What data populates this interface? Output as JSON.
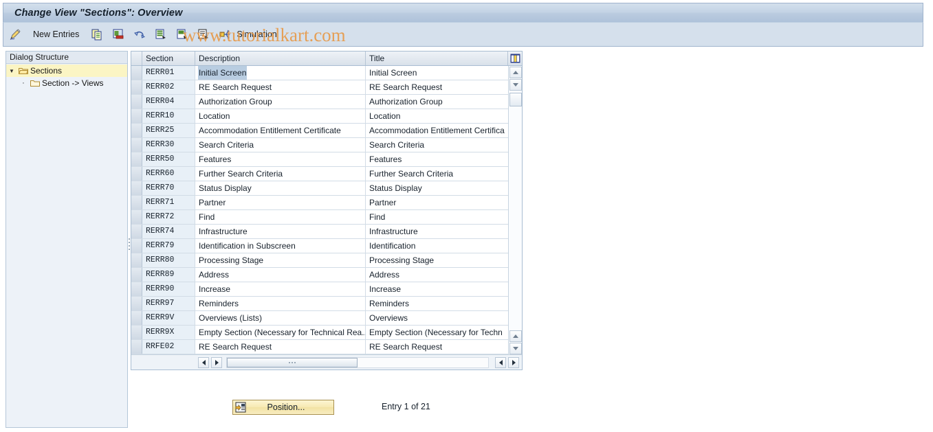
{
  "window": {
    "title": "Change View \"Sections\": Overview"
  },
  "watermark": {
    "text": "www.tutorialkart.com"
  },
  "toolbar": {
    "items": [
      {
        "icon": "pencil-edit-icon",
        "label": ""
      },
      {
        "icon": "new-entries-icon",
        "label": "New Entries"
      },
      {
        "icon": "copy-icon",
        "label": ""
      },
      {
        "icon": "paste-icon",
        "label": ""
      },
      {
        "icon": "undo-icon",
        "label": ""
      },
      {
        "icon": "select-all-icon",
        "label": ""
      },
      {
        "icon": "deselect-all-icon",
        "label": ""
      },
      {
        "icon": "details-icon",
        "label": ""
      },
      {
        "icon": "simulation-icon",
        "label": "Simulation"
      }
    ]
  },
  "sidebar": {
    "header": "Dialog Structure",
    "items": [
      {
        "label": "Sections",
        "icon": "open-folder-icon",
        "selected": true,
        "level": 0,
        "expanded": true
      },
      {
        "label": "Section -> Views",
        "icon": "folder-icon",
        "selected": false,
        "level": 1,
        "expanded": false
      }
    ]
  },
  "table": {
    "columns": [
      "Section",
      "Description",
      "Title"
    ],
    "rows": [
      {
        "section": "RERR01",
        "description": "Initial Screen",
        "title": "Initial Screen",
        "highlight": true
      },
      {
        "section": "RERR02",
        "description": "RE Search Request",
        "title": "RE Search Request",
        "highlight": false
      },
      {
        "section": "RERR04",
        "description": "Authorization Group",
        "title": "Authorization Group",
        "highlight": false
      },
      {
        "section": "RERR10",
        "description": "Location",
        "title": "Location",
        "highlight": false
      },
      {
        "section": "RERR25",
        "description": "Accommodation Entitlement Certificate",
        "title": "Accommodation Entitlement Certifica",
        "highlight": false
      },
      {
        "section": "RERR30",
        "description": "Search Criteria",
        "title": "Search Criteria",
        "highlight": false
      },
      {
        "section": "RERR50",
        "description": "Features",
        "title": "Features",
        "highlight": false
      },
      {
        "section": "RERR60",
        "description": "Further Search Criteria",
        "title": "Further Search Criteria",
        "highlight": false
      },
      {
        "section": "RERR70",
        "description": "Status Display",
        "title": "Status Display",
        "highlight": false
      },
      {
        "section": "RERR71",
        "description": "Partner",
        "title": "Partner",
        "highlight": false
      },
      {
        "section": "RERR72",
        "description": "Find",
        "title": "Find",
        "highlight": false
      },
      {
        "section": "RERR74",
        "description": "Infrastructure",
        "title": "Infrastructure",
        "highlight": false
      },
      {
        "section": "RERR79",
        "description": "Identification in Subscreen",
        "title": "Identification",
        "highlight": false
      },
      {
        "section": "RERR80",
        "description": "Processing Stage",
        "title": "Processing Stage",
        "highlight": false
      },
      {
        "section": "RERR89",
        "description": "Address",
        "title": "Address",
        "highlight": false
      },
      {
        "section": "RERR90",
        "description": "Increase",
        "title": "Increase",
        "highlight": false
      },
      {
        "section": "RERR97",
        "description": "Reminders",
        "title": "Reminders",
        "highlight": false
      },
      {
        "section": "RERR9V",
        "description": "Overviews (Lists)",
        "title": "Overviews",
        "highlight": false
      },
      {
        "section": "RERR9X",
        "description": "Empty Section (Necessary for Technical Rea...",
        "title": "Empty Section (Necessary for Techn",
        "highlight": false
      },
      {
        "section": "RRFE02",
        "description": "RE Search Request",
        "title": "RE Search Request",
        "highlight": false
      }
    ]
  },
  "footer": {
    "position_button": "Position...",
    "entry_count": "Entry 1 of 21"
  },
  "colors": {
    "title_bar": "#c3d3e5",
    "toolbar": "#d5e0ec",
    "tree_selected": "#fbf5c4",
    "cell_highlight": "#b9cde1",
    "section_column": "#e8f0f7",
    "watermark": "#e79a4a",
    "position_button": "#f6e9b2"
  }
}
